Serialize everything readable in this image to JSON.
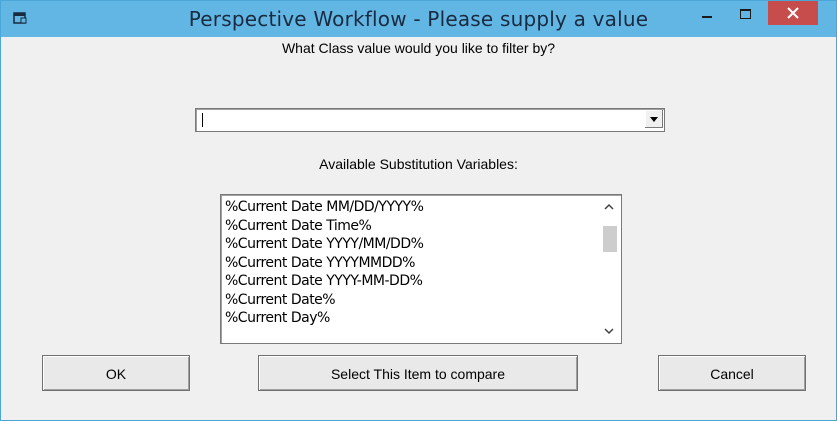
{
  "window": {
    "title": "Perspective Workflow - Please supply a value",
    "app_icon": "dialog-window-icon",
    "controls": {
      "minimize": "minimize-icon",
      "maximize": "maximize-icon",
      "close": "close-icon"
    },
    "titlebar_color": "#62b6e4",
    "close_color": "#c74d4d"
  },
  "prompt": "What Class value would you like to filter by?",
  "combo": {
    "value": "",
    "dropdown_icon": "dropdown-arrow-icon"
  },
  "substitution": {
    "label": "Available Substitution Variables:",
    "items": [
      "%Current Date MM/DD/YYYY%",
      "%Current Date Time%",
      "%Current Date YYYY/MM/DD%",
      "%Current Date YYYYMMDD%",
      "%Current Date YYYY-MM-DD%",
      "%Current Date%",
      "%Current Day%"
    ],
    "scroll_up_icon": "chevron-up-icon",
    "scroll_down_icon": "chevron-down-icon"
  },
  "buttons": {
    "ok": "OK",
    "compare": "Select This Item to compare",
    "cancel": "Cancel"
  }
}
